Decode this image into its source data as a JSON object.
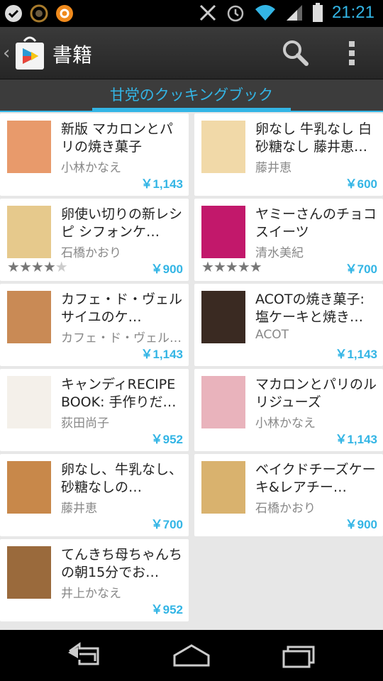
{
  "status_bar": {
    "time": "21:21",
    "left_icons": [
      "check-icon",
      "vpn-icon",
      "app-icon"
    ],
    "right_icons": [
      "nfc-icon",
      "alarm-icon",
      "wifi-icon",
      "signal-icon",
      "battery-icon"
    ]
  },
  "action_bar": {
    "title": "書籍",
    "logo": "play-store-icon",
    "actions": [
      "search-icon",
      "overflow-menu-icon"
    ]
  },
  "tab": {
    "label": "甘党のクッキングブック"
  },
  "books": [
    {
      "title": "新版 マカロンとパリの焼き菓子",
      "author": "小林かなえ",
      "price": "￥1,143",
      "rating": null,
      "cover": "#e89a6b"
    },
    {
      "title": "卵なし 牛乳なし 白砂糖なし 藤井恵…",
      "author": "藤井恵",
      "price": "￥600",
      "rating": null,
      "cover": "#f1d9a8"
    },
    {
      "title": "卵使い切りの新レシピ シフォンケ…",
      "author": "石橋かおり",
      "price": "￥900",
      "rating": 4,
      "cover": "#e6c98c"
    },
    {
      "title": "ヤミーさんのチョコスイーツ",
      "author": "清水美紀",
      "price": "￥700",
      "rating": 5,
      "cover": "#c2186b"
    },
    {
      "title": "カフェ・ド・ヴェルサイユのケ…",
      "author": "カフェ・ド・ヴェル…",
      "price": "￥1,143",
      "rating": null,
      "cover": "#c98a55"
    },
    {
      "title": "ACOTの焼き菓子: 塩ケーキと焼き…",
      "author": "ACOT",
      "price": "￥1,143",
      "rating": null,
      "cover": "#3a2a22"
    },
    {
      "title": "キャンディRECIPE BOOK: 手作りだ…",
      "author": "荻田尚子",
      "price": "￥952",
      "rating": null,
      "cover": "#f4f0ea"
    },
    {
      "title": "マカロンとパリのルリジューズ",
      "author": "小林かなえ",
      "price": "￥1,143",
      "rating": null,
      "cover": "#e9b3bc"
    },
    {
      "title": "卵なし、牛乳なし、砂糖なしの…",
      "author": "藤井恵",
      "price": "￥700",
      "rating": null,
      "cover": "#c8884a"
    },
    {
      "title": "ベイクドチーズケーキ&レアチー…",
      "author": "石橋かおり",
      "price": "￥900",
      "rating": null,
      "cover": "#d9b26e"
    },
    {
      "title": "てんきち母ちゃんちの朝15分でお…",
      "author": "井上かなえ",
      "price": "￥952",
      "rating": null,
      "cover": "#9a6a3c"
    }
  ],
  "nav": [
    "back-icon",
    "home-icon",
    "recent-apps-icon"
  ]
}
